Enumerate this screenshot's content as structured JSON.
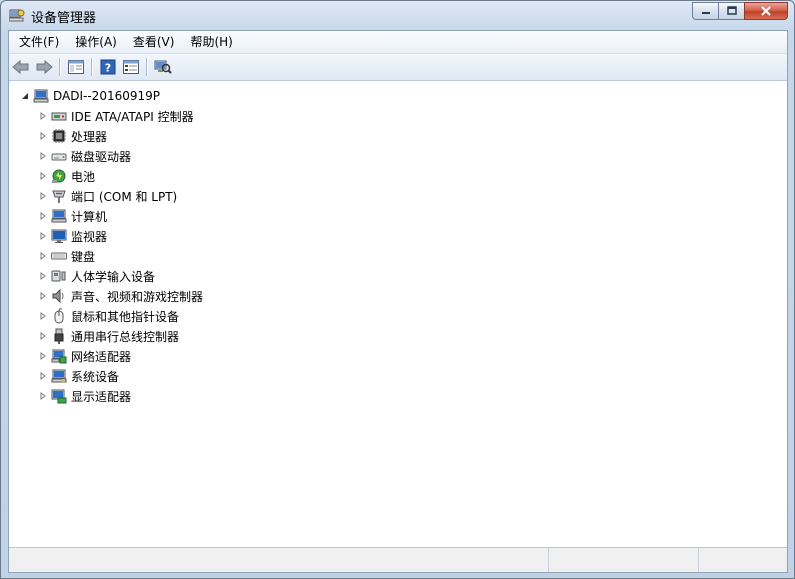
{
  "window": {
    "title": "设备管理器",
    "controls": {
      "minimize": "minimize",
      "maximize": "maximize",
      "close": "close"
    }
  },
  "menu": [
    {
      "label": "文件(F)",
      "id": "file"
    },
    {
      "label": "操作(A)",
      "id": "action"
    },
    {
      "label": "查看(V)",
      "id": "view"
    },
    {
      "label": "帮助(H)",
      "id": "help"
    }
  ],
  "toolbar": [
    {
      "id": "back",
      "icon": "arrow-left-icon"
    },
    {
      "id": "forward",
      "icon": "arrow-right-icon"
    },
    {
      "id": "show-hide-console-tree",
      "icon": "console-tree-icon"
    },
    {
      "id": "help",
      "icon": "help-icon"
    },
    {
      "id": "properties",
      "icon": "properties-icon"
    },
    {
      "id": "scan-hardware",
      "icon": "scan-hardware-icon"
    }
  ],
  "tree": {
    "root": {
      "label": "DADI--20160919P",
      "icon": "computer-icon",
      "expanded": true
    },
    "items": [
      {
        "label": "IDE ATA/ATAPI 控制器",
        "icon": "ide-controller-icon"
      },
      {
        "label": "处理器",
        "icon": "processor-icon"
      },
      {
        "label": "磁盘驱动器",
        "icon": "disk-drive-icon"
      },
      {
        "label": "电池",
        "icon": "battery-icon"
      },
      {
        "label": "端口 (COM 和 LPT)",
        "icon": "port-icon"
      },
      {
        "label": "计算机",
        "icon": "computer-icon"
      },
      {
        "label": "监视器",
        "icon": "monitor-icon"
      },
      {
        "label": "键盘",
        "icon": "keyboard-icon"
      },
      {
        "label": "人体学输入设备",
        "icon": "hid-icon"
      },
      {
        "label": "声音、视频和游戏控制器",
        "icon": "sound-icon"
      },
      {
        "label": "鼠标和其他指针设备",
        "icon": "mouse-icon"
      },
      {
        "label": "通用串行总线控制器",
        "icon": "usb-icon"
      },
      {
        "label": "网络适配器",
        "icon": "network-adapter-icon"
      },
      {
        "label": "系统设备",
        "icon": "system-device-icon"
      },
      {
        "label": "显示适配器",
        "icon": "display-adapter-icon"
      }
    ]
  },
  "status": {
    "panes": [
      "",
      "",
      ""
    ]
  }
}
